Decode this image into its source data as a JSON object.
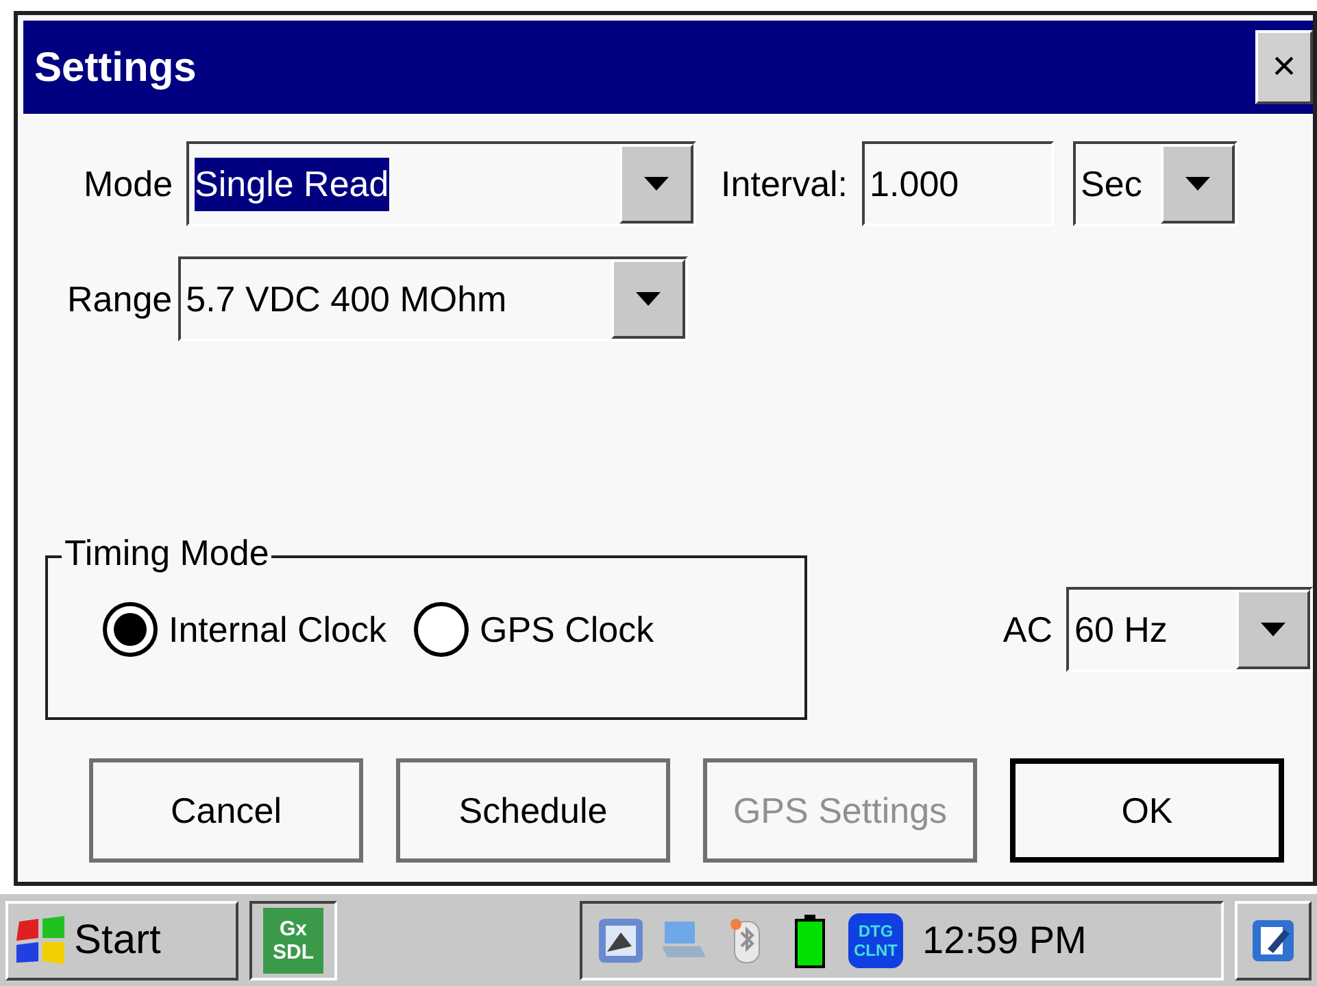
{
  "window": {
    "title": "Settings",
    "close": "×"
  },
  "mode": {
    "label": "Mode",
    "value": "Single Read",
    "value_selected": true
  },
  "interval": {
    "label": "Interval:",
    "value": "1.000"
  },
  "interval_unit": {
    "value": "Sec"
  },
  "range": {
    "label": "Range",
    "value": "5.7 VDC 400 MOhm"
  },
  "timing_mode": {
    "title": "Timing Mode",
    "options": [
      {
        "label": "Internal Clock",
        "selected": true
      },
      {
        "label": "GPS Clock",
        "selected": false
      }
    ]
  },
  "ac": {
    "label": "AC",
    "value": "60 Hz"
  },
  "buttons": [
    {
      "label": "Cancel",
      "disabled": false,
      "default": false
    },
    {
      "label": "Schedule",
      "disabled": false,
      "default": false
    },
    {
      "label": "GPS Settings",
      "disabled": true,
      "default": false
    },
    {
      "label": "OK",
      "disabled": false,
      "default": true
    }
  ],
  "taskbar": {
    "start": "Start",
    "app": {
      "line1": "Gx",
      "line2": "SDL"
    },
    "tray_app": {
      "line1": "DTG",
      "line2": "CLNT"
    },
    "clock": "12:59 PM"
  }
}
